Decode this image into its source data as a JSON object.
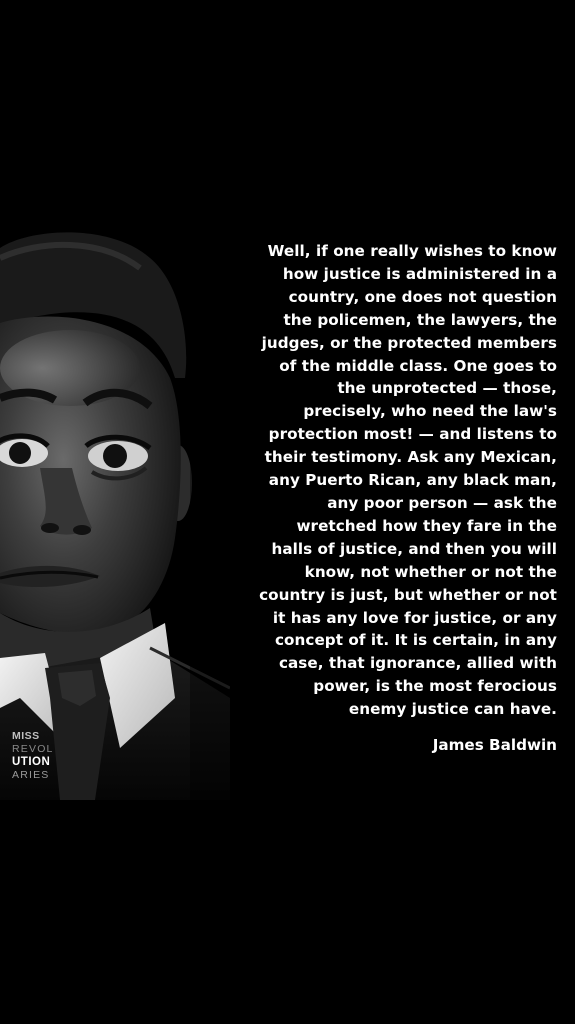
{
  "quote": {
    "lines": [
      "Well, if one really wishes to know",
      "how justice is administered in a",
      "country, one does not question",
      "the policemen, the lawyers, the",
      "judges, or the protected members",
      "of the middle class. One goes to",
      "the unprotected — those,",
      "precisely, who need the law's",
      "protection most! — and listens to",
      "their testimony. Ask any Mexican,",
      "any Puerto Rican, any black man,",
      "any poor person — ask the",
      "wretched how they fare in the",
      "halls of justice, and then you will",
      "know, not whether or not the",
      "country is just, but whether or not",
      "it has any love for justice, or any",
      "concept of it. It is certain, in any",
      "case, that ignorance, allied with",
      "power, is the most ferocious",
      "enemy justice can have."
    ],
    "author": "James Baldwin"
  },
  "logo": {
    "line1": "MISS",
    "line2": "REVOL",
    "line3": "UTION",
    "line4": "ARIES"
  },
  "colors": {
    "background": "#000000",
    "text": "#ffffff"
  }
}
